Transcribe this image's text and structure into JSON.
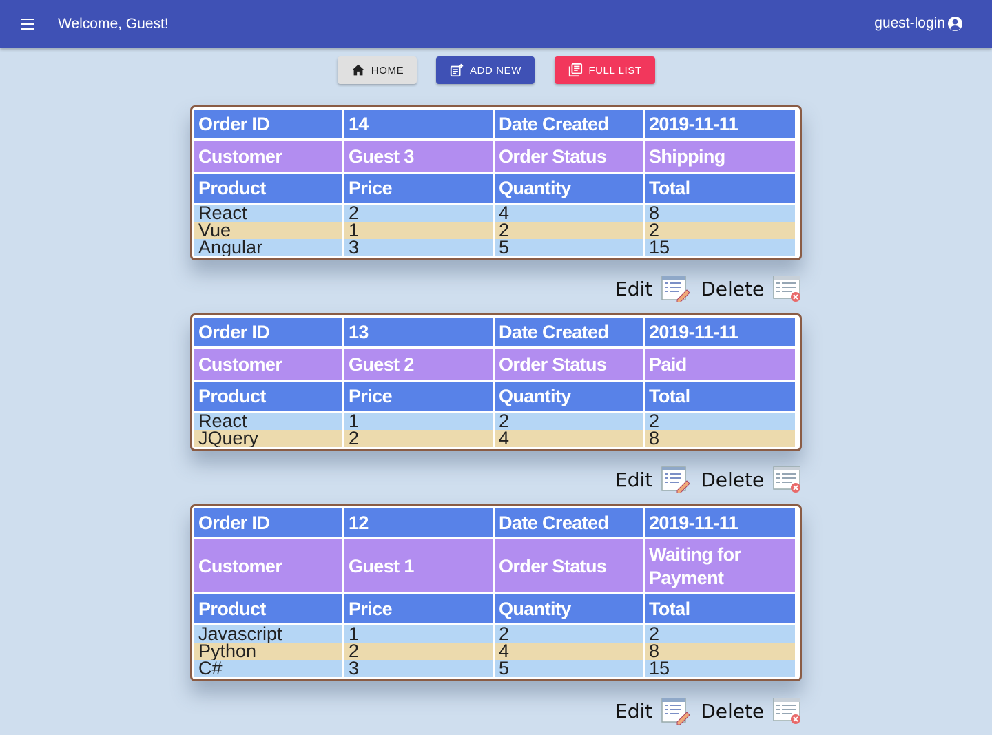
{
  "header": {
    "welcome": "Welcome, Guest!",
    "login": "guest-login"
  },
  "nav": {
    "home": "HOME",
    "add_new": "ADD NEW",
    "full_list": "FULL LIST"
  },
  "labels": {
    "order_id": "Order ID",
    "date_created": "Date Created",
    "customer": "Customer",
    "order_status": "Order Status",
    "product": "Product",
    "price": "Price",
    "quantity": "Quantity",
    "total": "Total",
    "edit": "Edit",
    "delete": "Delete"
  },
  "colors": {
    "appbar": "#3f51b5",
    "header_blue": "#5882e8",
    "header_purple": "#b28df0",
    "row_blue": "#b5d6f5",
    "row_tan": "#ecdaad",
    "full_list": "#f2375c"
  },
  "orders": [
    {
      "id": "14",
      "date": "2019-11-11",
      "customer": "Guest 3",
      "status": "Shipping",
      "items": [
        {
          "product": "React",
          "price": "2",
          "quantity": "4",
          "total": "8"
        },
        {
          "product": "Vue",
          "price": "1",
          "quantity": "2",
          "total": "2"
        },
        {
          "product": "Angular",
          "price": "3",
          "quantity": "5",
          "total": "15"
        }
      ]
    },
    {
      "id": "13",
      "date": "2019-11-11",
      "customer": "Guest 2",
      "status": "Paid",
      "items": [
        {
          "product": "React",
          "price": "1",
          "quantity": "2",
          "total": "2"
        },
        {
          "product": "JQuery",
          "price": "2",
          "quantity": "4",
          "total": "8"
        }
      ]
    },
    {
      "id": "12",
      "date": "2019-11-11",
      "customer": "Guest 1",
      "status": "Waiting for Payment",
      "items": [
        {
          "product": "Javascript",
          "price": "1",
          "quantity": "2",
          "total": "2"
        },
        {
          "product": "Python",
          "price": "2",
          "quantity": "4",
          "total": "8"
        },
        {
          "product": "C#",
          "price": "3",
          "quantity": "5",
          "total": "15"
        }
      ]
    }
  ]
}
